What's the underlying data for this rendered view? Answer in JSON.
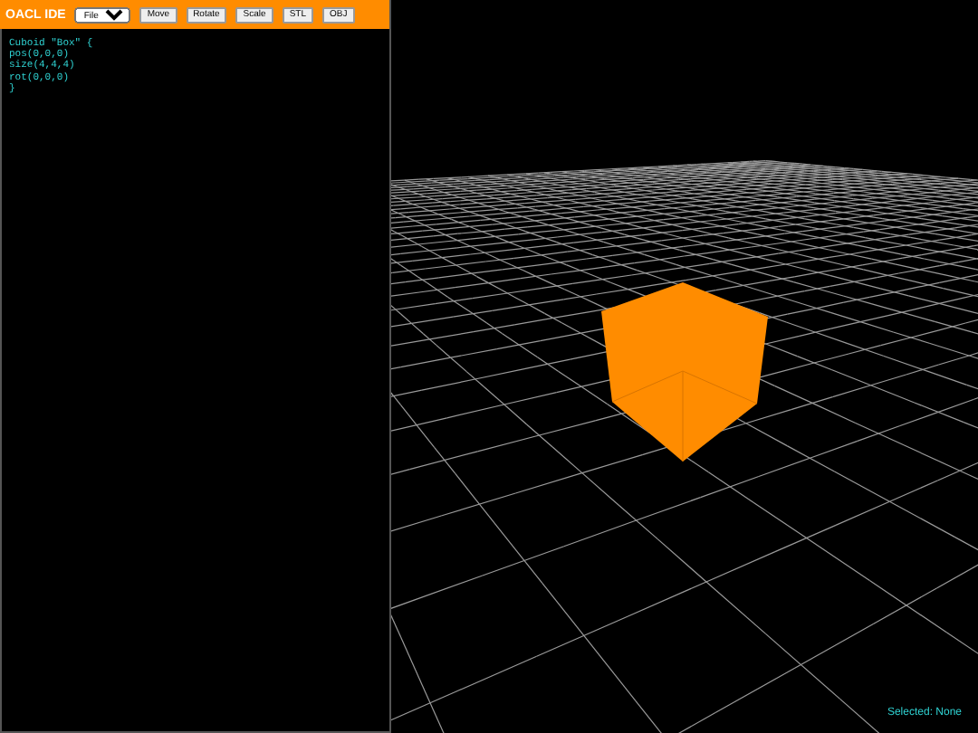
{
  "toolbar": {
    "title": "OACL IDE",
    "file_menu": {
      "value": "File"
    },
    "buttons": [
      "Move",
      "Rotate",
      "Scale",
      "STL",
      "OBJ"
    ]
  },
  "editor": {
    "lines": [
      "Cuboid \"Box\" {",
      "pos(0,0,0)",
      "size(4,4,4)",
      "rot(0,0,0)",
      "}"
    ]
  },
  "viewport": {
    "status": "Selected: None"
  }
}
